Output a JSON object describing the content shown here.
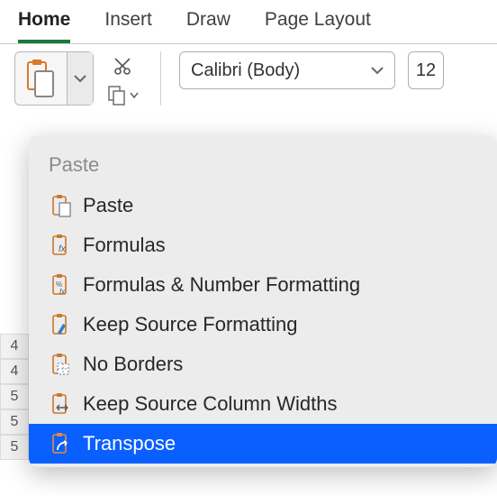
{
  "ribbon": {
    "tabs": [
      "Home",
      "Insert",
      "Draw",
      "Page Layout"
    ],
    "active_index": 0
  },
  "toolbar": {
    "font_name": "Calibri (Body)",
    "font_size": "12"
  },
  "paste_menu": {
    "header": "Paste",
    "items": [
      {
        "label": "Paste"
      },
      {
        "label": "Formulas"
      },
      {
        "label": "Formulas & Number Formatting"
      },
      {
        "label": "Keep Source Formatting"
      },
      {
        "label": "No Borders"
      },
      {
        "label": "Keep Source Column Widths"
      },
      {
        "label": "Transpose"
      }
    ],
    "highlight_index": 6
  },
  "row_headers": [
    "4",
    "4",
    "5",
    "5",
    "5"
  ]
}
